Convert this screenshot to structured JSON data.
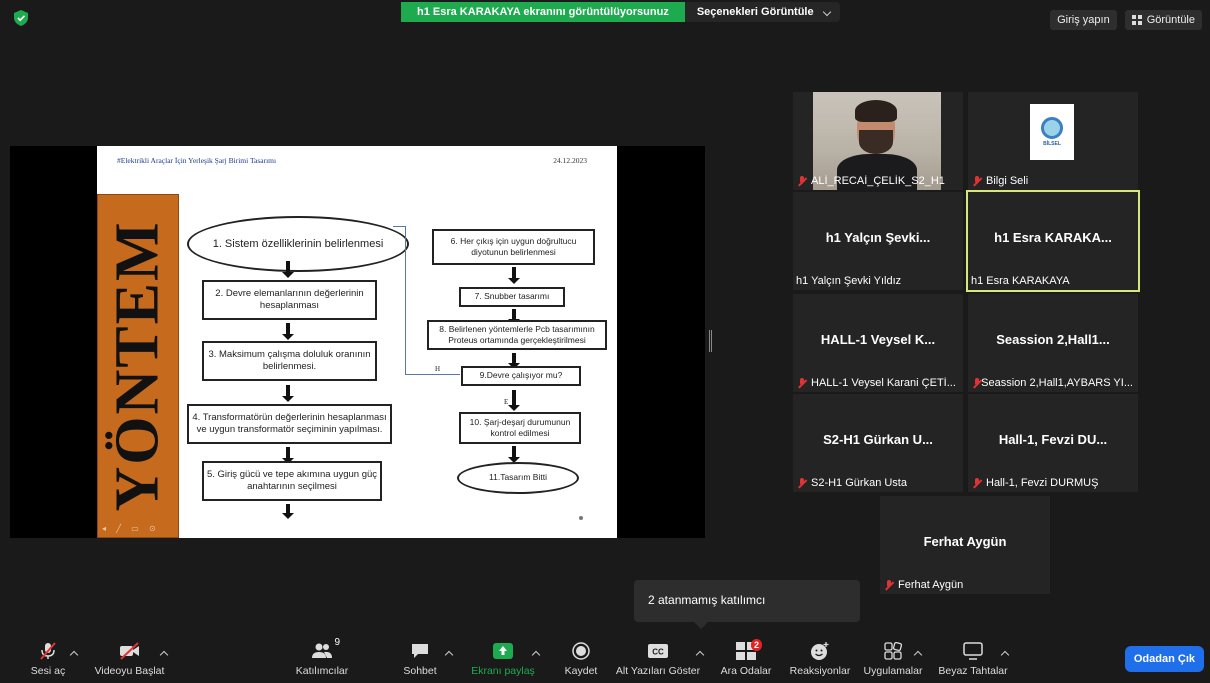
{
  "top": {
    "sharing_banner": "h1 Esra KARAKAYA ekranını görüntülüyorsunuz",
    "view_options": "Seçenekleri Görüntüle",
    "sign_in": "Giriş yapın",
    "view": "Görüntüle"
  },
  "slide": {
    "header_title": "#Elektrikli Araçlar İçin Yerleşik Şarj Birimi Tasarımı",
    "date": "24.12.2023",
    "side_title": "YÖNTEM",
    "steps_left": [
      "1. Sistem özelliklerinin belirlenmesi",
      "2. Devre elemanlarının değerlerinin hesaplanması",
      "3. Maksimum çalışma doluluk oranının belirlenmesi.",
      "4. Transformatörün değerlerinin hesaplanması ve uygun transformatör seçiminin yapılması.",
      "5. Giriş gücü ve tepe akımına uygun güç anahtarının seçilmesi"
    ],
    "steps_right": [
      "6. Her çıkış için uygun doğrultucu diyotunun belirlenmesi",
      "7. Snubber tasarımı",
      "8. Belirlenen yöntemlerle Pcb tasarımının Proteus ortamında gerçekleştirilmesi",
      "9.Devre çalışıyor mu?",
      "10. Şarj-deşarj durumunun kontrol edilmesi",
      "11.Tasarım Bitti"
    ],
    "label_h": "H",
    "label_e": "E"
  },
  "participants": [
    {
      "name": "",
      "label": "ALİ_RECAİ_ÇELİK_S2_H1",
      "muted": true,
      "type": "video"
    },
    {
      "name": "",
      "label": "Bilgi Seli",
      "muted": true,
      "type": "logo",
      "logo_text": "BİLSEL"
    },
    {
      "name": "h1 Yalçın Şevki...",
      "label": "h1 Yalçın Şevki Yıldız",
      "muted": false
    },
    {
      "name": "h1 Esra KARAKA...",
      "label": "h1 Esra KARAKAYA",
      "muted": false,
      "active": true
    },
    {
      "name": "HALL-1 Veysel K...",
      "label": "HALL-1 Veysel Karani ÇETİ...",
      "muted": true
    },
    {
      "name": "Seassion 2,Hall1...",
      "label": "Seassion 2,Hall1,AYBARS YI...",
      "muted": true
    },
    {
      "name": "S2-H1 Gürkan U...",
      "label": "S2-H1 Gürkan Usta",
      "muted": true
    },
    {
      "name": "Hall-1, Fevzi DU...",
      "label": "Hall-1, Fevzi DURMUŞ",
      "muted": true
    },
    {
      "name": "Ferhat Aygün",
      "label": "Ferhat Aygün",
      "muted": true
    }
  ],
  "popup": {
    "text": "2 atanmamış katılımcı"
  },
  "toolbar": {
    "unmute": "Sesi aç",
    "start_video": "Videoyu Başlat",
    "participants": "Katılımcılar",
    "participants_count": "9",
    "chat": "Sohbet",
    "share_screen": "Ekranı paylaş",
    "record": "Kaydet",
    "captions": "Alt Yazıları Göster",
    "breakout": "Ara Odalar",
    "breakout_badge": "2",
    "reactions": "Reaksiyonlar",
    "apps": "Uygulamalar",
    "whiteboard": "Beyaz Tahtalar",
    "leave": "Odadan Çık"
  },
  "colors": {
    "accent_green": "#1eaa4f",
    "leave_blue": "#1f6feb",
    "active_speaker": "#d8e67a",
    "mute_red": "#e03333",
    "slide_side_orange": "#c66a1e"
  },
  "icons": [
    "shield-icon",
    "mic-muted-icon",
    "video-off-icon",
    "participants-icon",
    "chat-icon",
    "share-screen-icon",
    "record-icon",
    "cc-icon",
    "breakout-rooms-icon",
    "reactions-icon",
    "apps-icon",
    "whiteboard-icon"
  ]
}
